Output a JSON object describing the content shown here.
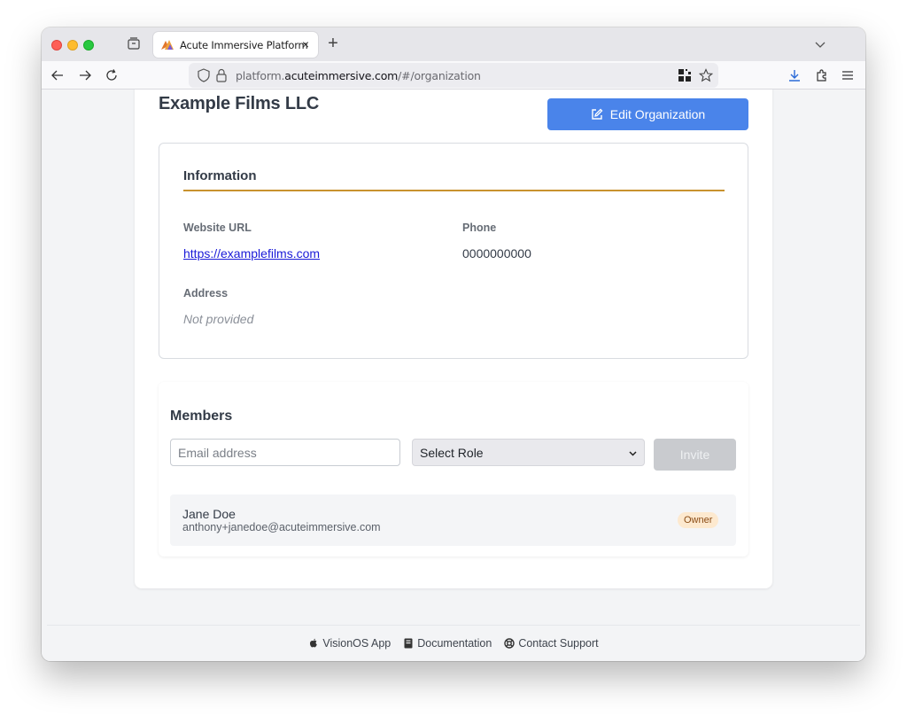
{
  "browser": {
    "tab": {
      "title": "Acute Immersive Platform",
      "close": "×"
    },
    "new_tab": "+",
    "url": {
      "prefix": "platform.",
      "host": "acuteimmersive.com",
      "path": "/#/organization"
    }
  },
  "organization": {
    "name": "Example Films LLC",
    "edit_label": "Edit Organization"
  },
  "information": {
    "heading": "Information",
    "website_label": "Website URL",
    "website_value": "https://examplefilms.com",
    "phone_label": "Phone",
    "phone_value": "0000000000",
    "address_label": "Address",
    "address_value": "Not provided"
  },
  "members": {
    "heading": "Members",
    "email_placeholder": "Email address",
    "role_selected": "Select Role",
    "invite_label": "Invite",
    "list": [
      {
        "name": "Jane Doe",
        "email": "anthony+janedoe@acuteimmersive.com",
        "role": "Owner"
      }
    ]
  },
  "footer": {
    "links": [
      {
        "label": "VisionOS App",
        "icon": "apple-icon"
      },
      {
        "label": "Documentation",
        "icon": "book-icon"
      },
      {
        "label": "Contact Support",
        "icon": "lifebuoy-icon"
      }
    ]
  },
  "colors": {
    "primary": "#4a84ea",
    "accent_rule": "#c8922e",
    "badge_bg": "#fde9cf",
    "badge_text": "#8a4b14"
  }
}
